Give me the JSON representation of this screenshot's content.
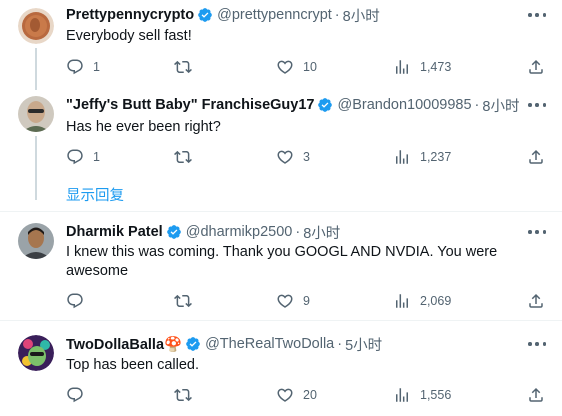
{
  "tweets": [
    {
      "name": "Prettypennycrypto",
      "handle": "@prettypenncrypt",
      "separator": "·",
      "time": "8小时",
      "text": "Everybody sell fast!",
      "replies": "1",
      "retweets": "",
      "likes": "10",
      "views": "1,473"
    },
    {
      "name": "\"Jeffy's Butt Baby\" FranchiseGuy17",
      "handle": "@Brandon10009985",
      "separator": "·",
      "time": "8小时",
      "text": "Has he ever been right?",
      "replies": "1",
      "retweets": "",
      "likes": "3",
      "views": "1,237"
    },
    {
      "name": "Dharmik Patel",
      "handle": "@dharmikp2500",
      "separator": "·",
      "time": "8小时",
      "text": "I knew this was coming. Thank you GOOGL AND NVDIA. You were awesome",
      "replies": "",
      "retweets": "",
      "likes": "9",
      "views": "2,069"
    },
    {
      "name": "TwoDollaBalla🍄",
      "handle": "@TheRealTwoDolla",
      "separator": "·",
      "time": "5小时",
      "text": "Top has been called.",
      "replies": "",
      "retweets": "",
      "likes": "20",
      "views": "1,556"
    }
  ],
  "show_replies_label": "显示回复",
  "icons": {
    "verified": "verified-badge-icon",
    "reply": "reply-icon",
    "retweet": "retweet-icon",
    "like": "like-icon",
    "views": "views-icon",
    "share": "share-icon",
    "more": "more-icon"
  },
  "colors": {
    "accent": "#1d9bf0",
    "muted": "#536471",
    "divider": "#eff3f4",
    "thread_line": "#cfd9de"
  }
}
